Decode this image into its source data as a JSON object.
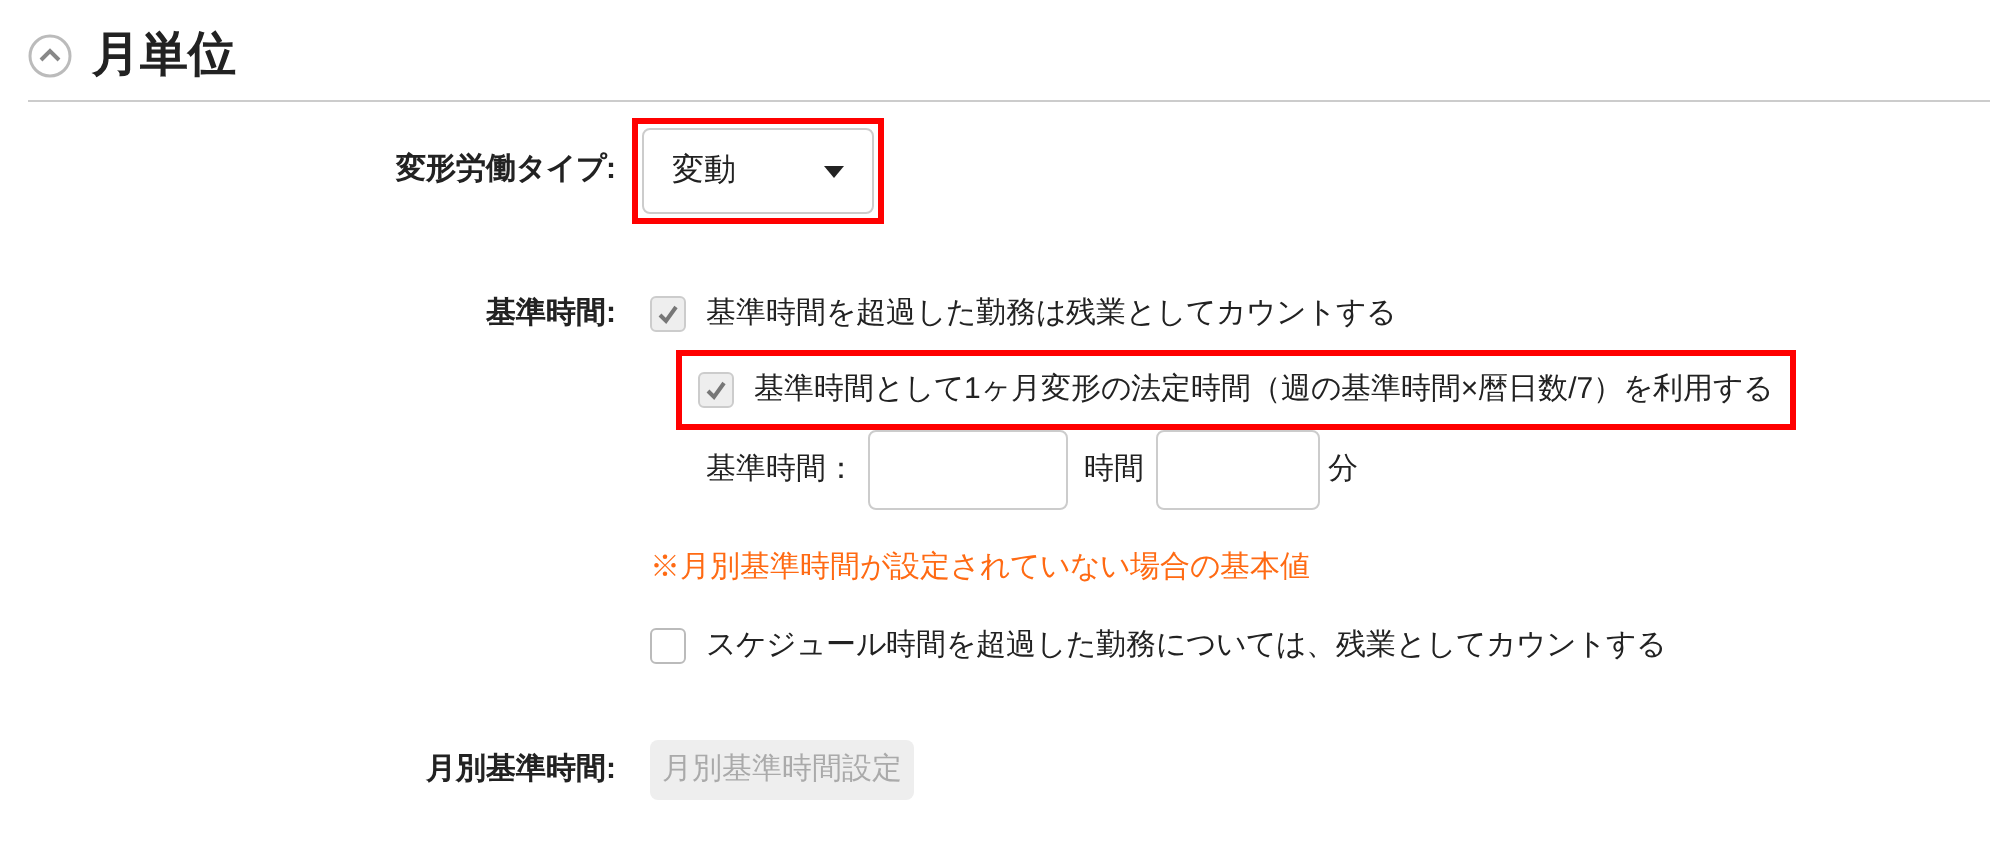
{
  "section": {
    "title": "月単位",
    "expanded": true
  },
  "work_type": {
    "label": "変形労働タイプ:",
    "value": "変動",
    "highlighted": true
  },
  "standard_time": {
    "label": "基準時間:",
    "options": [
      {
        "label": "基準時間を超過した勤務は残業としてカウントする",
        "checked": true,
        "disabled": true,
        "highlighted": false,
        "indented": false
      },
      {
        "label": "基準時間として1ヶ月変形の法定時間（週の基準時間×暦日数/7）を利用する",
        "checked": true,
        "disabled": true,
        "highlighted": true,
        "indented": true
      }
    ],
    "time_label": "基準時間：",
    "hours_unit": "時間",
    "minutes_unit": "分",
    "note": "※月別基準時間が設定されていない場合の基本値",
    "schedule_option": {
      "label": "スケジュール時間を超過した勤務については、残業としてカウントする",
      "checked": false,
      "disabled": false
    }
  },
  "monthly": {
    "label": "月別基準時間:",
    "button": "月別基準時間設定",
    "disabled": true
  }
}
